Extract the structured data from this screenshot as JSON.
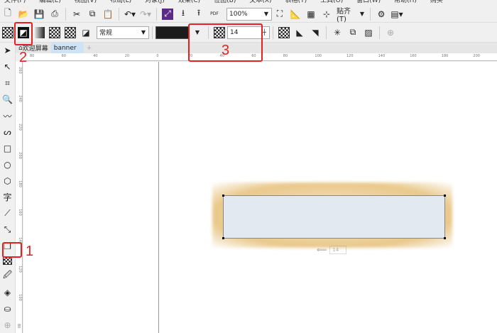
{
  "menu": [
    "文件(F)",
    "编辑(E)",
    "视图(V)",
    "布局(L)",
    "对象(J)",
    "效果(C)",
    "位图(B)",
    "文本(X)",
    "表格(T)",
    "工具(O)",
    "窗口(W)",
    "帮助(H)",
    "购买"
  ],
  "toolbar": {
    "zoom": "100%",
    "snap": "贴齐(T)",
    "pdf": "PDF"
  },
  "property_bar": {
    "blend_mode": "常规",
    "transparency": "14"
  },
  "tabs": {
    "welcome": "欢迎屏幕",
    "doc": "banner",
    "add": "+"
  },
  "ruler_h": [
    "80",
    "60",
    "40",
    "20",
    "0",
    "20",
    "40",
    "60",
    "80",
    "100",
    "120",
    "140",
    "160",
    "180",
    "200"
  ],
  "ruler_v": [
    "260",
    "240",
    "220",
    "200",
    "180",
    "160",
    "140",
    "120",
    "100",
    "80"
  ],
  "annotations": {
    "a1": "1",
    "a2": "2",
    "a3": "3"
  },
  "ghost_value": "14",
  "colors": {
    "annotation": "#e52020",
    "fill": "#e3e9f1",
    "glow": "#e9c88a"
  }
}
